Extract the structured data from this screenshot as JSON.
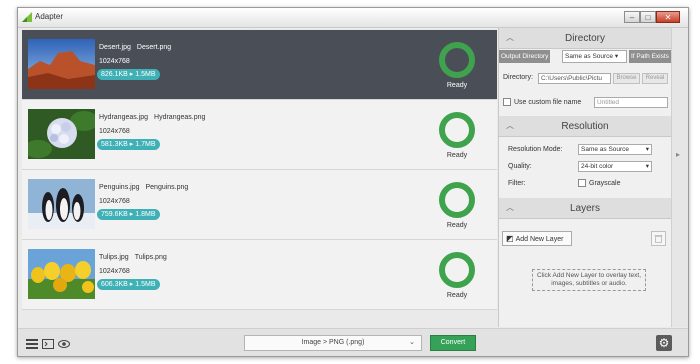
{
  "window": {
    "title": "Adapter",
    "controls": [
      "–",
      "□",
      "✕"
    ]
  },
  "files": [
    {
      "source": "Desert.jpg",
      "output": "Desert.png",
      "dimensions": "1024x768",
      "size": "826.1KB ▸ 1.5MB",
      "status": "Ready",
      "selected": true
    },
    {
      "source": "Hydrangeas.jpg",
      "output": "Hydrangeas.png",
      "dimensions": "1024x768",
      "size": "581.3KB ▸ 1.7MB",
      "status": "Ready",
      "selected": false
    },
    {
      "source": "Penguins.jpg",
      "output": "Penguins.png",
      "dimensions": "1024x768",
      "size": "759.6KB ▸ 1.8MB",
      "status": "Ready",
      "selected": false
    },
    {
      "source": "Tulips.jpg",
      "output": "Tulips.png",
      "dimensions": "1024x768",
      "size": "606.3KB ▸ 1.5MB",
      "status": "Ready",
      "selected": false
    }
  ],
  "bottombar": {
    "format": "Image > PNG (.png)",
    "convert": "Convert"
  },
  "directory": {
    "header": "Directory",
    "output_dir_label": "Output Directory",
    "same_as_source": "Same as Source",
    "if_path_exists": "If Path Exists",
    "directory_label": "Directory:",
    "directory_path": "C:\\Users\\Public\\Pictu",
    "browse": "Browse",
    "reveal": "Reveal",
    "custom_name_label": "Use custom file name",
    "custom_name_placeholder": "Untitled"
  },
  "resolution": {
    "header": "Resolution",
    "mode_label": "Resolution Mode:",
    "mode_value": "Same as Source",
    "quality_label": "Quality:",
    "quality_value": "24-bit color",
    "filter_label": "Filter:",
    "grayscale_label": "Grayscale"
  },
  "layers": {
    "header": "Layers",
    "add_button": "Add New Layer",
    "hint": "Click Add New Layer to overlay text, images, subtitles or audio."
  },
  "colors": {
    "accent_green": "#36a257",
    "ring_green": "#3fa34d",
    "badge_teal": "#3fb1b6",
    "selected_row": "#4a4f57"
  }
}
